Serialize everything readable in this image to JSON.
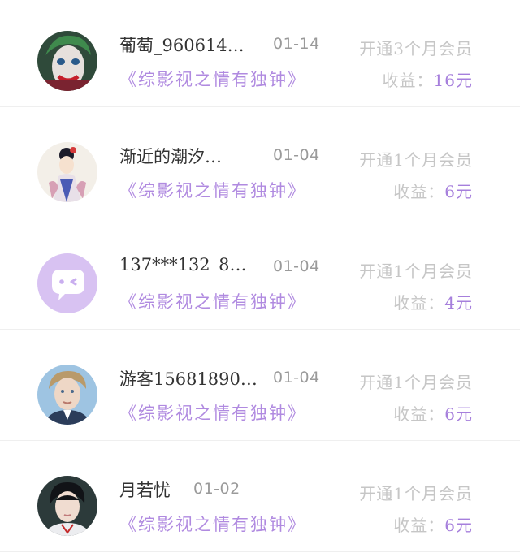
{
  "accent_purple": "#b08ae0",
  "records": [
    {
      "name": "葡萄_960614…",
      "date": "01-14",
      "desc": "开通3个月会员",
      "book": "《综影视之情有独钟》",
      "income_label": "收益：",
      "income_value": "16元",
      "avatar_icon": "clown-face-avatar"
    },
    {
      "name": "渐近的潮汐…",
      "date": "01-04",
      "desc": "开通1个月会员",
      "book": "《综影视之情有独钟》",
      "income_label": "收益：",
      "income_value": "6元",
      "avatar_icon": "illustrated-girl-avatar"
    },
    {
      "name": "137***132_8…",
      "date": "01-04",
      "desc": "开通1个月会员",
      "book": "《综影视之情有独钟》",
      "income_label": "收益：",
      "income_value": "4元",
      "avatar_icon": "default-chat-bubble-avatar"
    },
    {
      "name": "游客15681890…",
      "date": "01-04",
      "desc": "开通1个月会员",
      "book": "《综影视之情有独钟》",
      "income_label": "收益：",
      "income_value": "6元",
      "avatar_icon": "young-man-photo-avatar"
    },
    {
      "name": "月若忧",
      "date": "01-02",
      "desc": "开通1个月会员",
      "book": "《综影视之情有独钟》",
      "income_label": "收益：",
      "income_value": "6元",
      "avatar_icon": "dark-haired-boy-avatar"
    }
  ]
}
